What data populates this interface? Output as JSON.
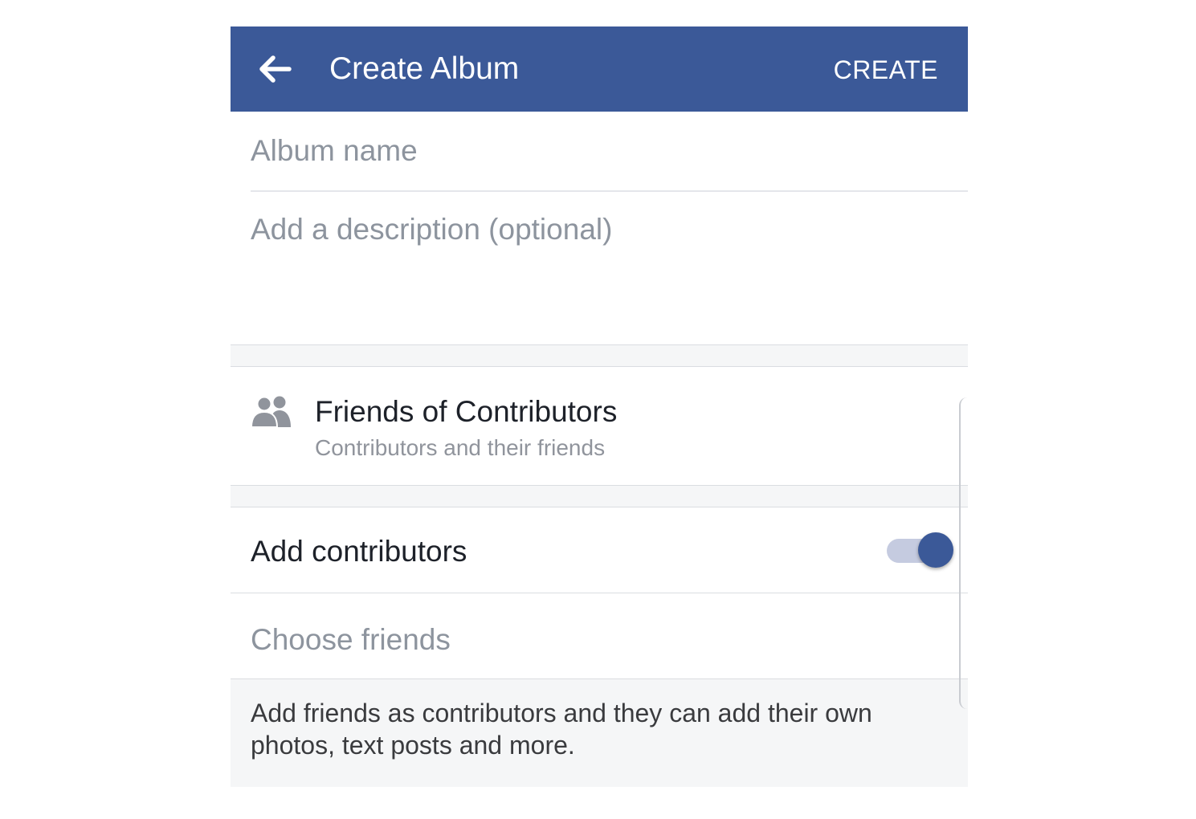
{
  "header": {
    "title": "Create Album",
    "create_label": "CREATE",
    "back_icon": "arrow-left-icon",
    "background": "#3b5998"
  },
  "form": {
    "album_name_placeholder": "Album name",
    "album_name_value": "",
    "description_placeholder": "Add a description (optional)",
    "description_value": ""
  },
  "privacy": {
    "icon": "friends-icon",
    "title": "Friends of Contributors",
    "subtitle": "Contributors and their friends"
  },
  "contributors": {
    "label": "Add contributors",
    "toggle_on": true,
    "toggle_color": "#3b5998",
    "choose_friends_placeholder": "Choose friends",
    "choose_friends_value": "",
    "info_text": "Add friends as contributors and they can add their own photos, text posts and more."
  }
}
